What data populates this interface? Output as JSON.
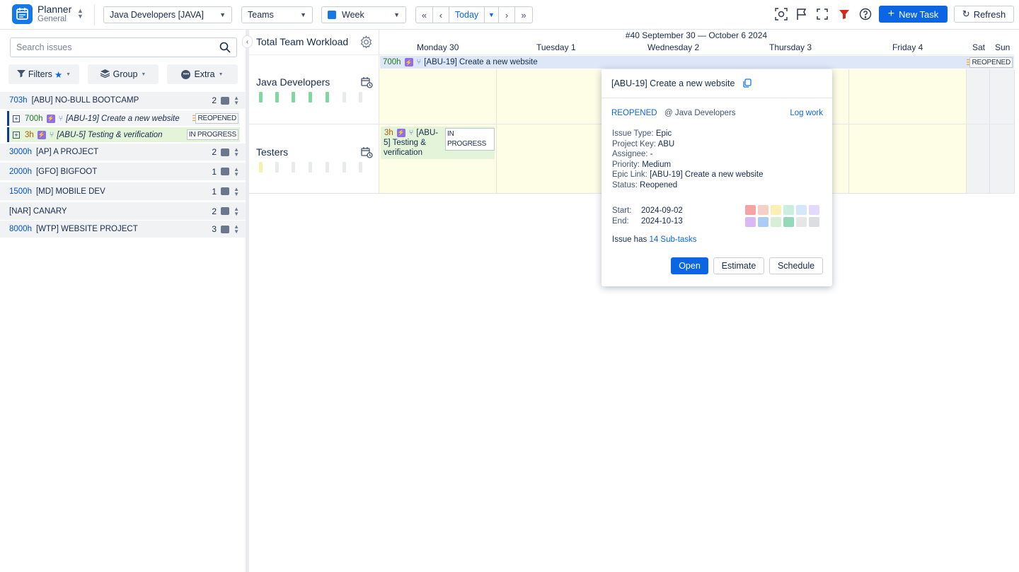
{
  "app": {
    "title": "Planner",
    "subtitle": "General"
  },
  "toolbar": {
    "team_select": "Java Developers [JAVA]",
    "view_select": "Teams",
    "period_select": "Week",
    "today_label": "Today",
    "new_task_label": "New Task",
    "refresh_label": "Refresh"
  },
  "sidebar": {
    "search_placeholder": "Search issues",
    "filters_label": "Filters",
    "group_label": "Group",
    "extra_label": "Extra",
    "groups": [
      {
        "hours": "703h",
        "name": "[ABU] NO-BULL BOOTCAMP",
        "count": "2"
      },
      {
        "hours": "3000h",
        "name": "[AP] A PROJECT",
        "count": "2"
      },
      {
        "hours": "2000h",
        "name": "[GFO] BIGFOOT",
        "count": "1"
      },
      {
        "hours": "1500h",
        "name": "[MD] MOBILE DEV",
        "count": "1"
      },
      {
        "hours": "",
        "name": "[NAR] CANARY",
        "count": "2"
      },
      {
        "hours": "8000h",
        "name": "[WTP] WEBSITE PROJECT",
        "count": "3"
      }
    ],
    "tasks": [
      {
        "hours": "700h",
        "title": "[ABU-19] Create a new website",
        "status": "REOPENED"
      },
      {
        "hours": "3h",
        "title": "[ABU-5] Testing & verification",
        "status": "IN PROGRESS"
      }
    ]
  },
  "calendar": {
    "workload_title": "Total Team Workload",
    "week_title": "#40 September 30 — October 6 2024",
    "days": [
      "Monday 30",
      "Tuesday 1",
      "Wednesday 2",
      "Thursday 3",
      "Friday 4",
      "Sat",
      "Sun"
    ],
    "teams": [
      "Java Developers",
      "Testers"
    ],
    "epic_bar": {
      "hours": "700h",
      "title": "[ABU-19] Create a new website",
      "status": "REOPENED"
    },
    "task_card": {
      "hours": "3h",
      "title_line1": "[ABU-",
      "title_line2": "5] Testing &",
      "title_line3": "verification",
      "status": "IN PROGRESS"
    }
  },
  "popup": {
    "title": "[ABU-19] Create a new website",
    "status": "REOPENED",
    "team": "@ Java Developers",
    "log_work": "Log work",
    "issue_type_label": "Issue Type:",
    "issue_type": "Epic",
    "project_key_label": "Project Key:",
    "project_key": "ABU",
    "assignee_label": "Assignee:",
    "assignee": "-",
    "priority_label": "Priority:",
    "priority": "Medium",
    "epic_link_label": "Epic Link:",
    "epic_link": "[ABU-19] Create a new website",
    "status_label": "Status:",
    "status_value": "Reopened",
    "start_label": "Start:",
    "start": "2024-09-02",
    "end_label": "End:",
    "end": "2024-10-13",
    "subtasks_prefix": "Issue has",
    "subtasks_link": "14 Sub-tasks",
    "open_label": "Open",
    "estimate_label": "Estimate",
    "schedule_label": "Schedule",
    "colors": [
      "#f5a3a3",
      "#f8cfc4",
      "#fbefb6",
      "#c9efe0",
      "#d6e6fb",
      "#e3dafb",
      "#d9b8f5",
      "#a9cdf7",
      "#d7efd5",
      "#94d9b9",
      "#e6e6e6",
      "#dcdde0"
    ]
  }
}
